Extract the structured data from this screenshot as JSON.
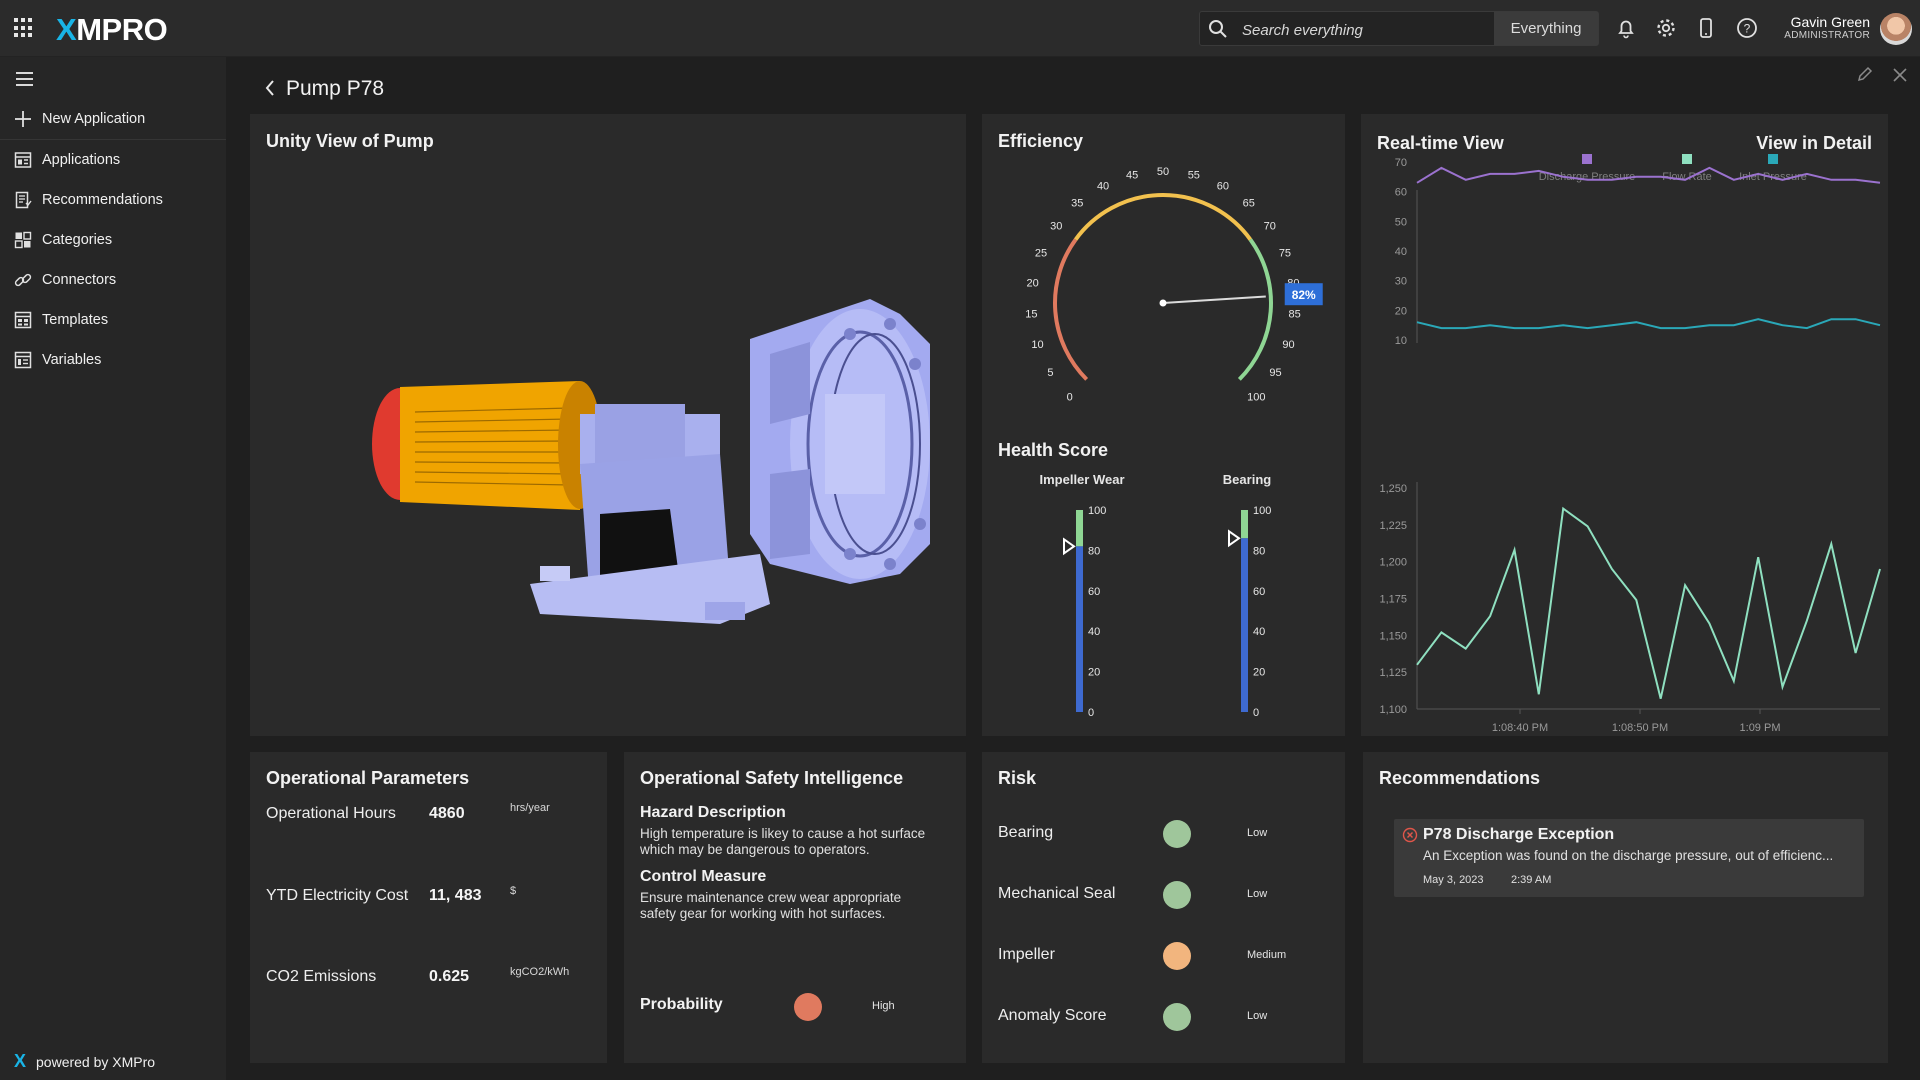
{
  "app": {
    "logo_x": "X",
    "logo_rest": "MPRO"
  },
  "search": {
    "placeholder": "Search everything",
    "scope": "Everything"
  },
  "user": {
    "name": "Gavin Green",
    "role": "ADMINISTRATOR"
  },
  "sidebar": {
    "items": [
      {
        "label": "New Application",
        "icon": "plus-icon"
      },
      {
        "label": "Applications",
        "icon": "applications-icon"
      },
      {
        "label": "Recommendations",
        "icon": "recommendations-icon"
      },
      {
        "label": "Categories",
        "icon": "categories-icon"
      },
      {
        "label": "Connectors",
        "icon": "link-icon"
      },
      {
        "label": "Templates",
        "icon": "templates-icon"
      },
      {
        "label": "Variables",
        "icon": "variables-icon"
      }
    ],
    "powered_by": "powered by XMPro"
  },
  "page": {
    "title": "Pump P78"
  },
  "unity": {
    "title": "Unity View of Pump"
  },
  "efficiency": {
    "title": "Efficiency",
    "value_label": "82%",
    "value": 82,
    "ticks": [
      "0",
      "5",
      "10",
      "15",
      "20",
      "25",
      "30",
      "35",
      "40",
      "45",
      "50",
      "55",
      "60",
      "65",
      "70",
      "75",
      "80",
      "85",
      "90",
      "95",
      "100"
    ],
    "colors": {
      "low": "#e07a5f",
      "mid": "#f2c14e",
      "high": "#8fd694"
    }
  },
  "health": {
    "title": "Health Score",
    "bars": [
      {
        "label": "Impeller Wear",
        "value": 82,
        "ticks": [
          "100",
          "80",
          "60",
          "40",
          "20",
          "0"
        ]
      },
      {
        "label": "Bearing",
        "value": 86,
        "ticks": [
          "100",
          "80",
          "60",
          "40",
          "20",
          "0"
        ]
      }
    ]
  },
  "realtime": {
    "title": "Real-time View",
    "detail_link": "View in Detail",
    "legend": [
      {
        "name": "Discharge Pressure",
        "color": "#9b72cf"
      },
      {
        "name": "Flow Rate",
        "color": "#8fe0c0"
      },
      {
        "name": "Inlet Pressure",
        "color": "#2aa8b8"
      }
    ],
    "top_yticks": [
      "70",
      "60",
      "50",
      "40",
      "30",
      "20",
      "10"
    ],
    "bottom_yticks": [
      "1,250",
      "1,225",
      "1,200",
      "1,175",
      "1,150",
      "1,125",
      "1,100"
    ],
    "xticks": [
      "1:08:40 PM",
      "1:08:50 PM",
      "1:09 PM"
    ]
  },
  "chart_data": {
    "type": "line",
    "title": "Real-time View",
    "x": [
      "1:08:35",
      "1:08:37",
      "1:08:39",
      "1:08:41",
      "1:08:43",
      "1:08:45",
      "1:08:47",
      "1:08:49",
      "1:08:51",
      "1:08:53",
      "1:08:55",
      "1:08:57",
      "1:08:59",
      "1:09:01",
      "1:09:03",
      "1:09:05",
      "1:09:07",
      "1:09:09",
      "1:09:11",
      "1:09:13"
    ],
    "series": [
      {
        "name": "Discharge Pressure",
        "axis": "top",
        "values": [
          63,
          68,
          64,
          66,
          66,
          67,
          65,
          64,
          64,
          65,
          65,
          64,
          68,
          64,
          66,
          64,
          66,
          64,
          64,
          63
        ]
      },
      {
        "name": "Inlet Pressure",
        "axis": "top",
        "values": [
          16,
          14,
          14,
          15,
          14,
          14,
          15,
          14,
          15,
          16,
          14,
          14,
          15,
          15,
          17,
          15,
          14,
          17,
          17,
          15
        ]
      },
      {
        "name": "Flow Rate",
        "axis": "bottom",
        "values": [
          1130,
          1152,
          1141,
          1163,
          1208,
          1110,
          1236,
          1224,
          1195,
          1174,
          1107,
          1184,
          1158,
          1119,
          1203,
          1115,
          1160,
          1212,
          1138,
          1195
        ]
      }
    ],
    "top_ylim": [
      10,
      70
    ],
    "bottom_ylim": [
      1100,
      1250
    ],
    "xticks": [
      "1:08:40 PM",
      "1:08:50 PM",
      "1:09 PM"
    ]
  },
  "operational": {
    "title": "Operational Parameters",
    "rows": [
      {
        "label": "Operational Hours",
        "value": "4860",
        "unit": "hrs/year"
      },
      {
        "label": "YTD Electricity Cost",
        "value": "11, 483",
        "unit": "$"
      },
      {
        "label": "CO2 Emissions",
        "value": "0.625",
        "unit": "kgCO2/kWh"
      }
    ]
  },
  "safety": {
    "title": "Operational Safety Intelligence",
    "hazard_title": "Hazard Description",
    "hazard_text_1": "High temperature is likey to cause a hot surface",
    "hazard_text_2": "which may be dangerous to operators.",
    "control_title": "Control Measure",
    "control_text_1": "Ensure maintenance crew wear appropriate",
    "control_text_2": "safety gear for working with hot surfaces.",
    "probability_label": "Probability",
    "probability_value": "High",
    "probability_color": "#e07a5f"
  },
  "risk": {
    "title": "Risk",
    "items": [
      {
        "label": "Bearing",
        "level": "Low",
        "color": "#9fc69b"
      },
      {
        "label": "Mechanical Seal",
        "level": "Low",
        "color": "#9fc69b"
      },
      {
        "label": "Impeller",
        "level": "Medium",
        "color": "#f2b57e"
      },
      {
        "label": "Anomaly Score",
        "level": "Low",
        "color": "#9fc69b"
      }
    ]
  },
  "recommendations": {
    "title": "Recommendations",
    "items": [
      {
        "title": "P78 Discharge Exception",
        "text": "An Exception was found on the discharge pressure, out of efficienc...",
        "date": "May 3, 2023",
        "time": "2:39 AM"
      }
    ]
  }
}
